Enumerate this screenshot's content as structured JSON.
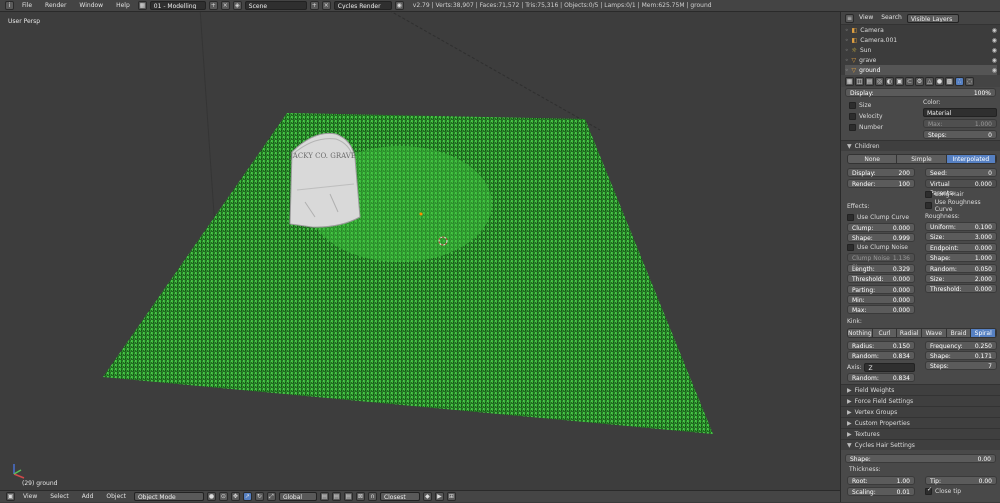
{
  "topbar": {
    "menus": [
      "File",
      "Render",
      "Window",
      "Help"
    ],
    "layout": "01 - Modelling",
    "scene": "Scene",
    "engine": "Cycles Render",
    "stats": "v2.79 | Verts:38,907 | Faces:71,572 | Tris:75,316 | Objects:0/5 | Lamps:0/1 | Mem:625.75M | ground"
  },
  "viewport": {
    "title": "User Persp",
    "object_label": "(29) ground",
    "headstone_text": "JACKY CO. GRAVE"
  },
  "bottombar": {
    "menus": [
      "View",
      "Select",
      "Add",
      "Object"
    ],
    "mode": "Object Mode",
    "orientation": "Global",
    "snap": "Closest"
  },
  "outliner": {
    "tabs": [
      "View",
      "Search",
      "Visible Layers"
    ],
    "items": [
      "Camera",
      "Camera.001",
      "Sun",
      "grave",
      "ground"
    ]
  },
  "props": {
    "display": {
      "label": "Display:",
      "value": "100%"
    },
    "left_checks": [
      "Size",
      "Velocity",
      "Number"
    ],
    "color": {
      "label": "Color:",
      "value": "Material",
      "max_label": "Max:",
      "max": "1.000",
      "steps_label": "Steps:",
      "steps": "0"
    },
    "children": {
      "title": "Children",
      "modes": [
        "None",
        "Simple",
        "Interpolated"
      ],
      "active": "Interpolated",
      "display_label": "Display:",
      "display": "200",
      "render_label": "Render:",
      "render": "100",
      "seed_label": "Seed:",
      "seed": "0",
      "virtual_label": "Virtual Parents:",
      "virtual": "0.000",
      "long_hair": "Long Hair",
      "use_rough_curve": "Use Roughness Curve"
    },
    "effects": {
      "title": "Effects:",
      "use_clump_curve": "Use Clump Curve",
      "clump_label": "Clump:",
      "clump": "0.000",
      "shape_label": "Shape:",
      "shape": "0.999",
      "use_clump_noise": "Use Clump Noise",
      "clump_noise_label": "Clump Noise Si",
      "clump_noise": "1.136",
      "length_label": "Length:",
      "length": "0.329",
      "threshold_label": "Threshold:",
      "threshold": "0.000",
      "parting_label": "Parting:",
      "parting": "0.000",
      "min_label": "Min:",
      "min": "0.000",
      "max_label": "Max:",
      "max": "0.000"
    },
    "roughness": {
      "title": "Roughness:",
      "uniform_label": "Uniform:",
      "uniform": "0.100",
      "size_label": "Size:",
      "size": "3.000",
      "endpoint_label": "Endpoint:",
      "endpoint": "0.000",
      "shape_label": "Shape:",
      "shape": "1.000",
      "random_label": "Random:",
      "random": "0.050",
      "size2_label": "Size:",
      "size2": "2.000",
      "threshold_label": "Threshold:",
      "threshold": "0.000"
    },
    "kink": {
      "title": "Kink:",
      "modes": [
        "Nothing",
        "Curl",
        "Radial",
        "Wave",
        "Braid",
        "Spiral"
      ],
      "active": "Spiral",
      "radius_label": "Radius:",
      "radius": "0.150",
      "random_label": "Random:",
      "random": "0.834",
      "frequency_label": "Frequency:",
      "frequency": "0.250",
      "shape_label": "Shape:",
      "shape": "0.171",
      "steps_label": "Steps:",
      "steps": "7",
      "axis_label": "Axis:",
      "axis": "Z",
      "random2_label": "Random:",
      "random2": "0.834"
    },
    "panels": [
      "Field Weights",
      "Force Field Settings",
      "Vertex Groups",
      "Custom Properties",
      "Textures",
      "Cycles Hair Settings"
    ],
    "cycles": {
      "shape_label": "Shape:",
      "shape": "0.00",
      "thickness": "Thickness:",
      "root_label": "Root:",
      "root": "1.00",
      "tip_label": "Tip:",
      "tip": "0.00",
      "scaling_label": "Scaling:",
      "scaling": "0.01",
      "close_tip": "Close tip"
    }
  }
}
